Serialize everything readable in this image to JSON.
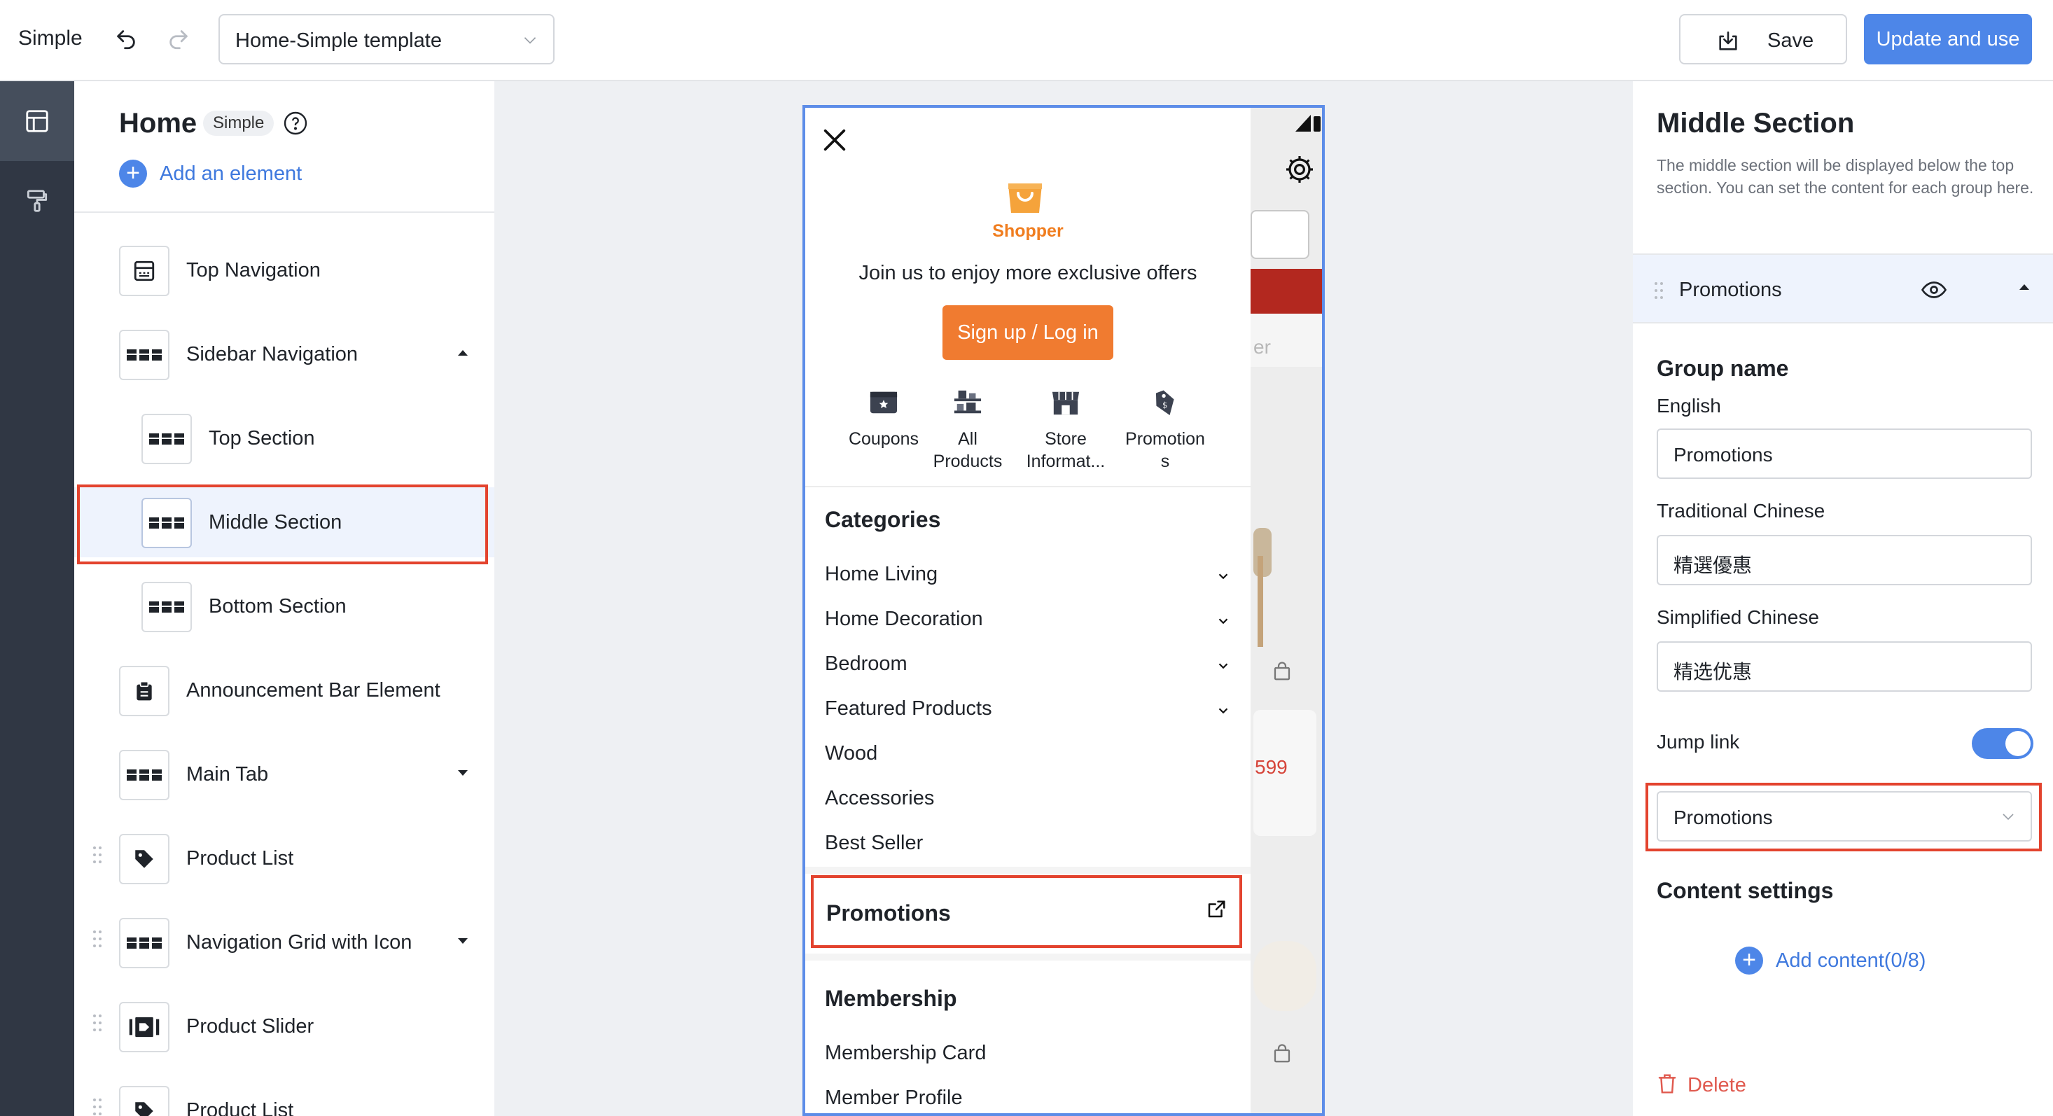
{
  "app": {
    "name": "Simple"
  },
  "toolbar": {
    "template_select": "Home-Simple template",
    "save_label": "Save",
    "update_label": "Update and use"
  },
  "rail": {
    "items": [
      "layout-icon",
      "paint-roller-icon"
    ],
    "active_index": 0
  },
  "left_panel": {
    "title": "Home",
    "badge": "Simple",
    "add_element": "Add an element",
    "components": [
      {
        "label": "Top Navigation",
        "icon": "navbar-icon"
      },
      {
        "label": "Sidebar Navigation",
        "icon": "grid-row-icon",
        "expanded": true
      },
      {
        "label": "Top Section",
        "icon": "grid-row-icon",
        "child": true
      },
      {
        "label": "Middle Section",
        "icon": "grid-row-icon",
        "child": true,
        "selected": true
      },
      {
        "label": "Bottom Section",
        "icon": "grid-row-icon",
        "child": true
      },
      {
        "label": "Announcement Bar Element",
        "icon": "clipboard-icon"
      },
      {
        "label": "Main Tab",
        "icon": "grid-row-icon",
        "expanded": false
      },
      {
        "label": "Product List",
        "icon": "tag-icon",
        "draggable": true
      },
      {
        "label": "Navigation Grid with Icon",
        "icon": "grid-row-icon",
        "draggable": true,
        "expanded": false
      },
      {
        "label": "Product Slider",
        "icon": "slider-icon",
        "draggable": true
      },
      {
        "label": "Product List",
        "icon": "tag-icon",
        "draggable": true
      }
    ]
  },
  "preview": {
    "brand": "Shopper",
    "join_text": "Join us to enjoy more exclusive offers",
    "signup_label": "Sign up / Log in",
    "quick_links": [
      {
        "label1": "Coupons",
        "label2": "",
        "icon": "coupon-icon"
      },
      {
        "label1": "All",
        "label2": "Products",
        "icon": "shelf-icon"
      },
      {
        "label1": "Store",
        "label2": "Informat...",
        "icon": "store-icon"
      },
      {
        "label1": "Promotion",
        "label2": "s",
        "icon": "price-tag-icon"
      }
    ],
    "categories_title": "Categories",
    "categories": [
      {
        "label": "Home Living",
        "has_children": true
      },
      {
        "label": "Home Decoration",
        "has_children": true
      },
      {
        "label": "Bedroom",
        "has_children": true
      },
      {
        "label": "Featured Products",
        "has_children": true
      },
      {
        "label": "Wood",
        "has_children": false
      },
      {
        "label": "Accessories",
        "has_children": false
      },
      {
        "label": "Best Seller",
        "has_children": false
      }
    ],
    "promotions_label": "Promotions",
    "membership_title": "Membership",
    "membership_items": [
      "Membership Card",
      "Member Profile"
    ],
    "background": {
      "tab_text": "er",
      "price": "599"
    }
  },
  "right_panel": {
    "title": "Middle Section",
    "description": "The middle section will be displayed below the top section. You can set the content for each group here.",
    "group_header": "Promotions",
    "group_name_title": "Group name",
    "fields": [
      {
        "label": "English",
        "value": "Promotions"
      },
      {
        "label": "Traditional Chinese",
        "value": "精選優惠"
      },
      {
        "label": "Simplified Chinese",
        "value": "精选优惠"
      }
    ],
    "jump_link_label": "Jump link",
    "jump_link_enabled": true,
    "jump_link_value": "Promotions",
    "content_settings_title": "Content settings",
    "add_content_label": "Add content(0/8)",
    "delete_label": "Delete"
  },
  "colors": {
    "accent": "#4d86e8",
    "highlight_outline": "#e3432e",
    "brand_orange": "#f07b30",
    "rail_bg": "#303744"
  }
}
